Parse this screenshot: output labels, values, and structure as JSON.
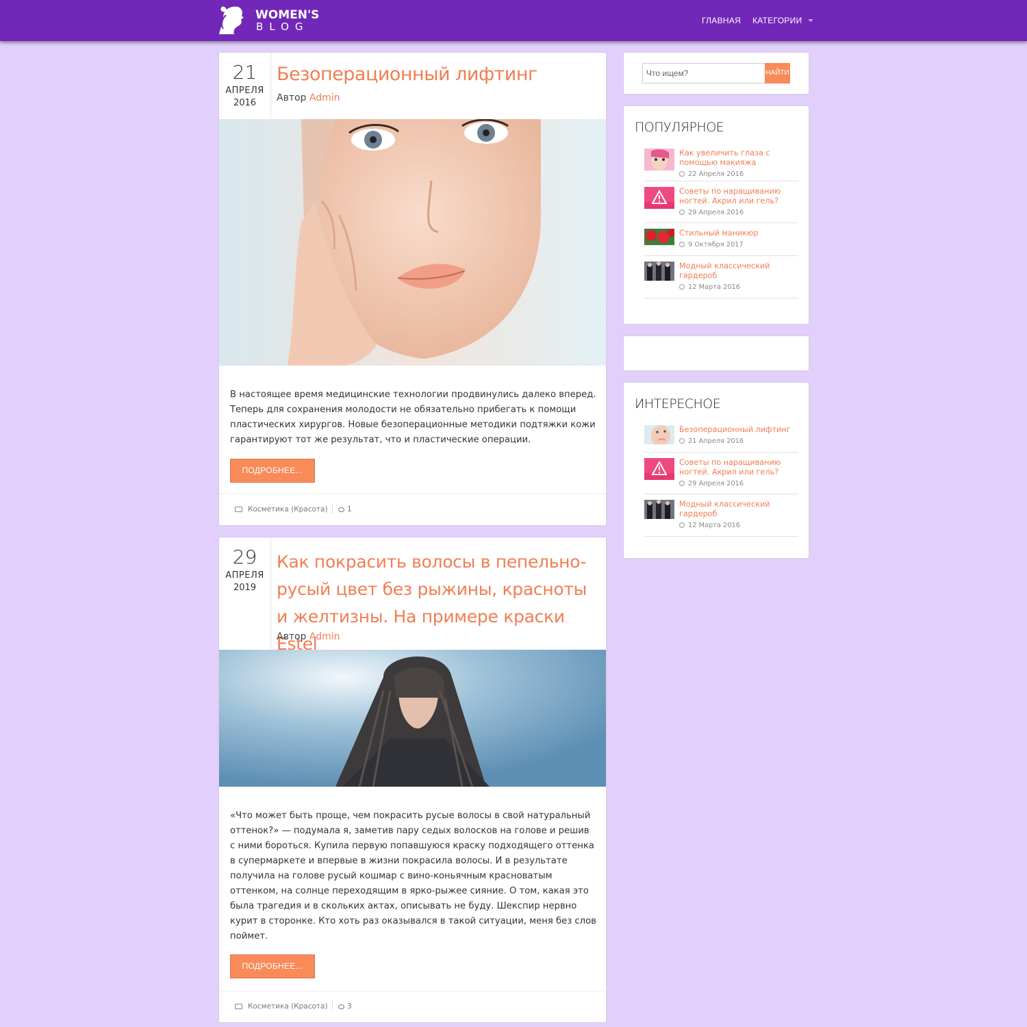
{
  "header": {
    "logo_line1": "WOMEN'S",
    "logo_line2": "BLOG",
    "nav_home": "ГЛАВНАЯ",
    "nav_categories": "КАТЕГОРИИ",
    "bar_color": "#7127b8"
  },
  "colors": {
    "accent": "#f27d52",
    "button": "#f98a5a",
    "background": "#e2cffb"
  },
  "posts": [
    {
      "day": "21",
      "month": "АПРЕЛЯ",
      "year": "2016",
      "title": "Безоперационный лифтинг",
      "author_label": "Автор",
      "author": "Admin",
      "excerpt": "В настоящее время медицинские технологии продвинулись далеко вперед. Теперь для сохранения молодости не обязательно прибегать к помощи пластических хирургов. Новые безоперационные методики подтяжки кожи гарантируют тот же результат, что и пластические операции.",
      "more_label": "ПОДРОБНЕЕ...",
      "category": "Косметика (Красота)",
      "comments": "1"
    },
    {
      "day": "29",
      "month": "АПРЕЛЯ",
      "year": "2019",
      "title": "Как покрасить волосы в пепельно-русый цвет без рыжины, красноты и желтизны. На примере краски Estel",
      "author_label": "Автор",
      "author": "Admin",
      "excerpt": "«Что может быть проще, чем покрасить русые волосы в свой натуральный оттенок?» — подумала я, заметив пару седых волосков на голове и решив с ними бороться. Купила первую попавшуюся краску подходящего оттенка в супермаркете и впервые в жизни покрасила волосы. И в результате получила на голове русый кошмар с вино-коньячным красноватым оттенком, на солнце переходящим в ярко-рыжее сияние. О том, какая это была трагедия и в скольких актах, описывать не буду. Шекспир нервно курит в сторонке. Кто хоть раз оказывался в такой ситуации, меня без слов поймет.",
      "more_label": "ПОДРОБНЕЕ...",
      "category": "Косметика (Красота)",
      "comments": "3"
    }
  ],
  "sidebar": {
    "search_placeholder": "Что ищем?",
    "search_button": "НАЙТИ",
    "popular_title": "ПОПУЛЯРНОЕ",
    "popular": [
      {
        "title": "Как увеличить глаза с помощью макияжа",
        "date": "22 Апреля 2016",
        "thumb": "makeup"
      },
      {
        "title": "Советы по наращиванию ногтей. Акрил или гель?",
        "date": "29 Апреля 2016",
        "thumb": "warning"
      },
      {
        "title": "Стильный маникюр",
        "date": "9 Октября 2017",
        "thumb": "roses"
      },
      {
        "title": "Модный классический гардероб",
        "date": "12 Марта 2016",
        "thumb": "wardrobe"
      }
    ],
    "interesting_title": "ИНТЕРЕСНОЕ",
    "interesting": [
      {
        "title": "Безоперационный лифтинг",
        "date": "21 Апреля 2016",
        "thumb": "face"
      },
      {
        "title": "Советы по наращиванию ногтей. Акрил или гель?",
        "date": "29 Апреля 2016",
        "thumb": "warning"
      },
      {
        "title": "Модный классический гардероб",
        "date": "12 Марта 2016",
        "thumb": "wardrobe"
      }
    ]
  }
}
